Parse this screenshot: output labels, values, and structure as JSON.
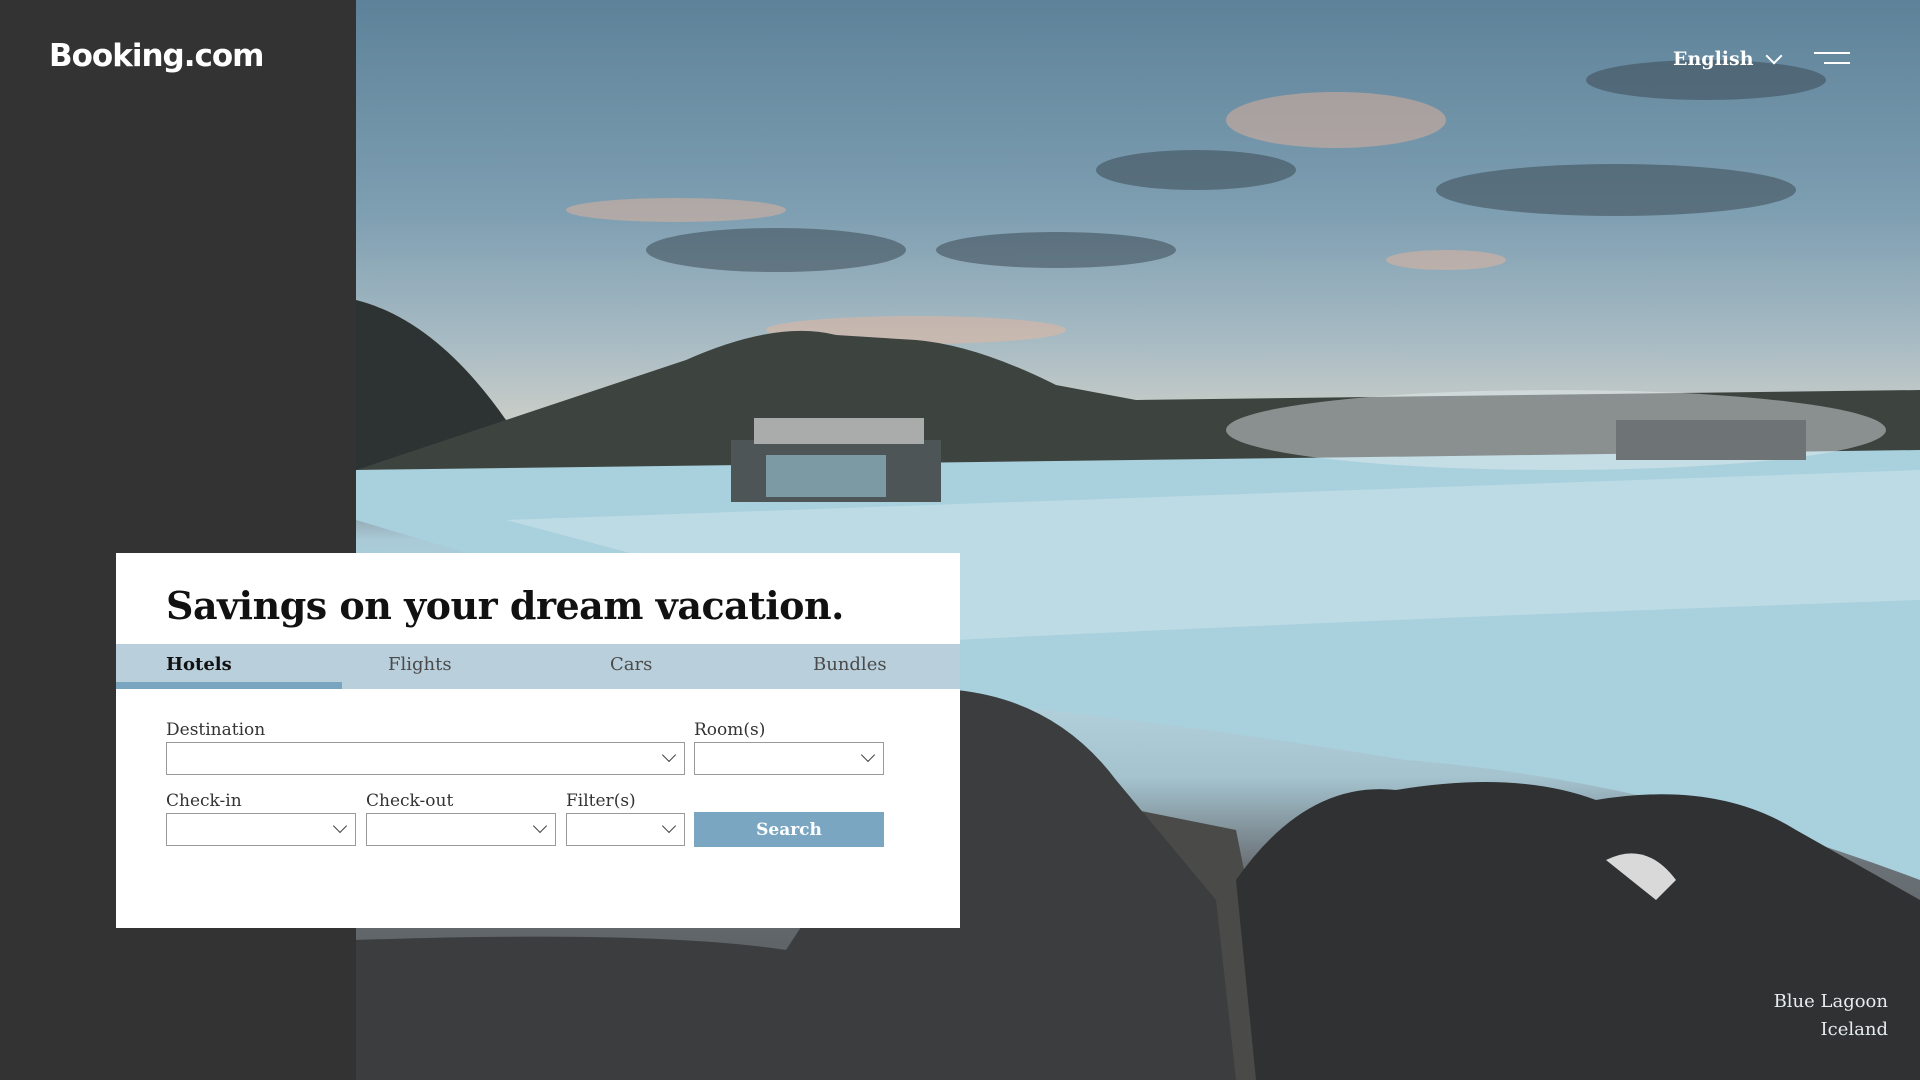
{
  "brand": {
    "logo_text": "Booking.com"
  },
  "header": {
    "language": "English"
  },
  "hero": {
    "caption_line1": "Blue Lagoon",
    "caption_line2": "Iceland"
  },
  "search_card": {
    "title": "Savings on your dream vacation.",
    "tabs": [
      {
        "label": "Hotels",
        "active": true
      },
      {
        "label": "Flights",
        "active": false
      },
      {
        "label": "Cars",
        "active": false
      },
      {
        "label": "Bundles",
        "active": false
      }
    ],
    "fields": {
      "destination": {
        "label": "Destination",
        "value": ""
      },
      "rooms": {
        "label": "Room(s)",
        "value": ""
      },
      "checkin": {
        "label": "Check-in",
        "value": ""
      },
      "checkout": {
        "label": "Check-out",
        "value": ""
      },
      "filters": {
        "label": "Filter(s)",
        "value": ""
      }
    },
    "search_label": "Search"
  },
  "colors": {
    "sidebar": "#333333",
    "tab_bar": "#b9cfdb",
    "accent": "#7aa6c2"
  }
}
